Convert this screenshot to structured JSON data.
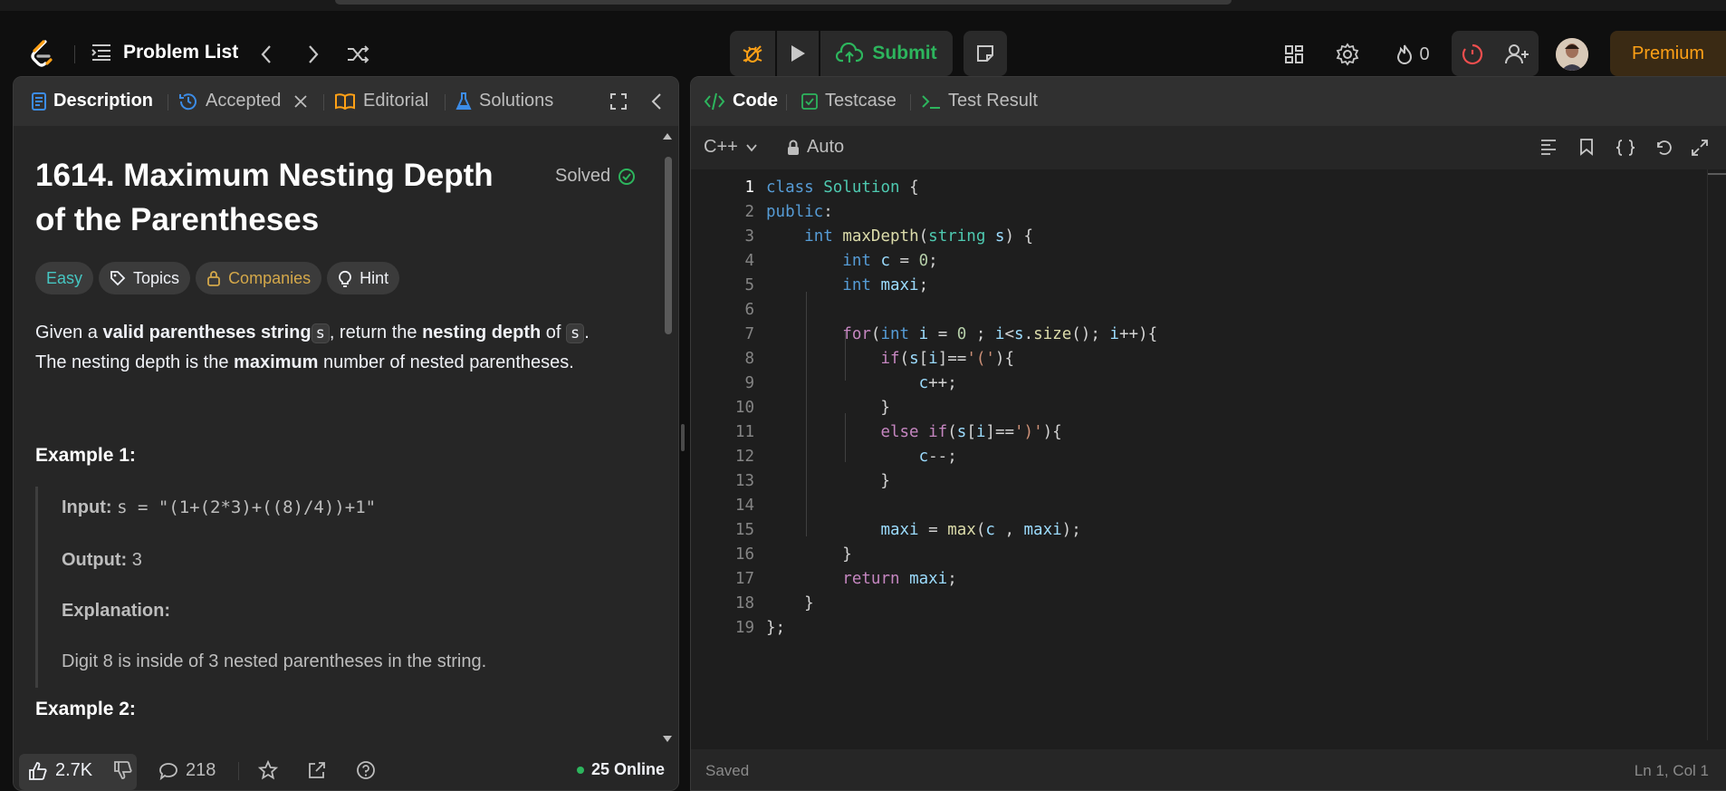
{
  "nav": {
    "problem_list": "Problem List",
    "submit": "Submit",
    "streak_count": "0",
    "premium": "Premium"
  },
  "left": {
    "tabs": {
      "description": "Description",
      "accepted": "Accepted",
      "editorial": "Editorial",
      "solutions": "Solutions"
    },
    "title_line1": "1614. Maximum Nesting Depth",
    "title_line2": "of the Parentheses",
    "solved": "Solved",
    "chips": {
      "easy": "Easy",
      "topics": "Topics",
      "companies": "Companies",
      "hint": "Hint"
    },
    "desc": {
      "p1_a": "Given a ",
      "p1_b": "valid parentheses string",
      "p1_c": ", return the ",
      "p1_d": "nesting depth",
      "p1_e": " of ",
      "p1_f": ".",
      "var_s": "s",
      "p2_a": "The nesting depth is the ",
      "p2_b": "maximum",
      "p2_c": " number of nested parentheses."
    },
    "example1": {
      "heading": "Example 1:",
      "input_label": "Input:",
      "input_value": "s = \"(1+(2*3)+((8)/4))+1\"",
      "output_label": "Output:",
      "output_value": "3",
      "explanation_label": "Explanation:",
      "explanation_text": "Digit 8 is inside of 3 nested parentheses in the string."
    },
    "example2_heading": "Example 2:",
    "footer": {
      "likes": "2.7K",
      "comments": "218",
      "online": "25 Online"
    }
  },
  "right": {
    "tabs": {
      "code": "Code",
      "testcase": "Testcase",
      "test_result": "Test Result"
    },
    "language": "C++",
    "auto": "Auto",
    "footer": {
      "saved": "Saved",
      "cursor": "Ln 1, Col 1"
    },
    "line_numbers": [
      "1",
      "2",
      "3",
      "4",
      "5",
      "6",
      "7",
      "8",
      "9",
      "10",
      "11",
      "12",
      "13",
      "14",
      "15",
      "16",
      "17",
      "18",
      "19"
    ]
  },
  "colors": {
    "accent": "#ffa116",
    "success": "#2db55d",
    "easy": "#46c6c2"
  }
}
